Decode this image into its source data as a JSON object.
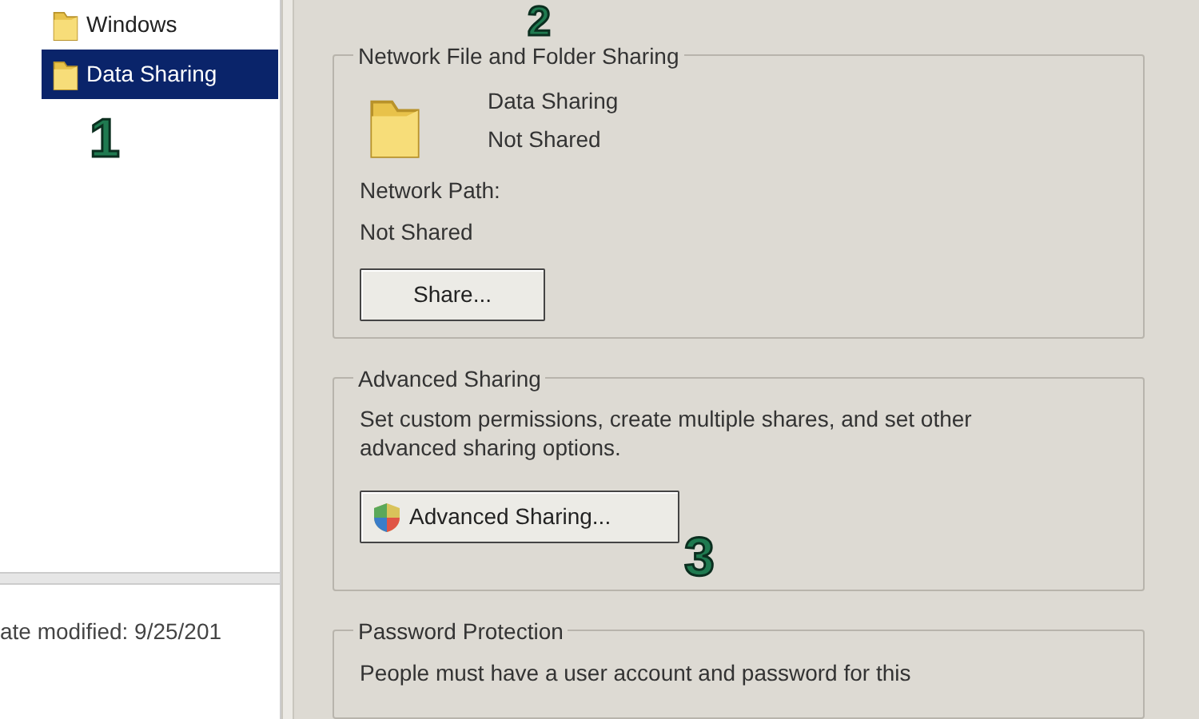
{
  "tree": {
    "items": [
      {
        "label": "Windows",
        "selected": false
      },
      {
        "label": "Data Sharing",
        "selected": true
      }
    ]
  },
  "details": {
    "date_modified": "ate modified:  9/25/201"
  },
  "sharing_panel": {
    "network_sharing": {
      "title": "Network File and Folder Sharing",
      "folder_name": "Data Sharing",
      "folder_status": "Not Shared",
      "path_label": "Network Path:",
      "path_value": "Not Shared",
      "button": "Share..."
    },
    "advanced_sharing": {
      "title": "Advanced Sharing",
      "description": "Set custom permissions, create multiple shares, and set other advanced sharing options.",
      "button": "Advanced Sharing..."
    },
    "password_protection": {
      "title": "Password Protection",
      "description": "People must have a user account and password for this"
    }
  },
  "annotations": [
    {
      "label": "1"
    },
    {
      "label": "2"
    },
    {
      "label": "3"
    }
  ]
}
